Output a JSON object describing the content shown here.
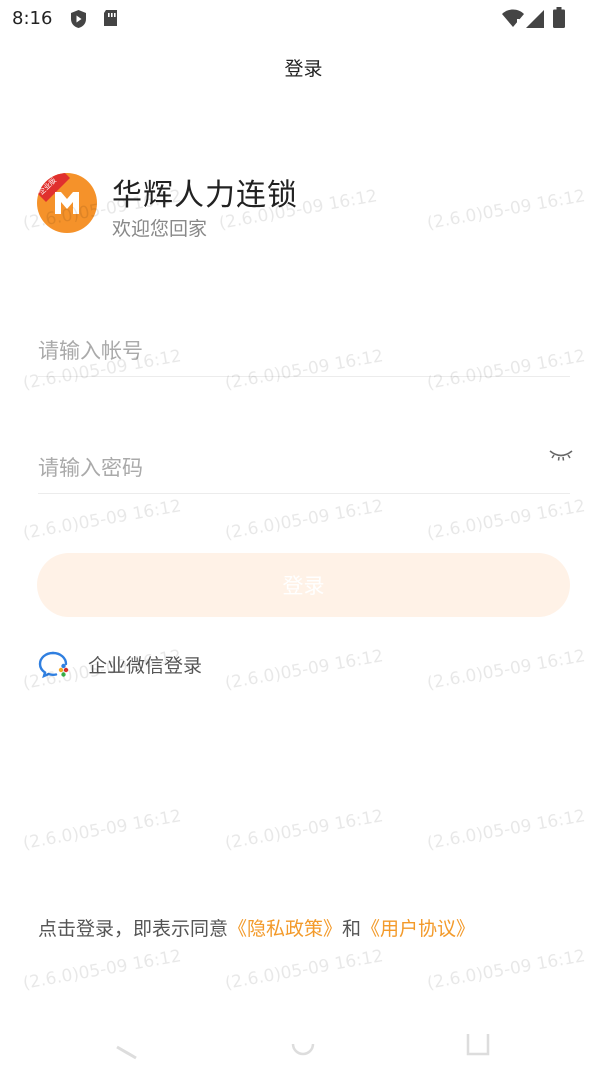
{
  "status_bar": {
    "time": "8:16",
    "left_icons": [
      "shield-icon",
      "sim-card-icon"
    ],
    "right_icons": [
      "wifi-icon",
      "signal-icon",
      "battery-icon"
    ]
  },
  "header": {
    "title": "登录"
  },
  "brand": {
    "logo_badge": "企业版",
    "app_name": "华辉人力连锁",
    "welcome": "欢迎您回家"
  },
  "form": {
    "account_value": "",
    "account_placeholder": "请输入帐号",
    "password_value": "",
    "password_placeholder": "请输入密码",
    "password_toggle_icon": "eye-closed-icon",
    "submit_label": "登录"
  },
  "alt_login": {
    "icon": "wecom-icon",
    "label": "企业微信登录"
  },
  "agreement": {
    "prefix": "点击登录，即表示同意",
    "privacy_link": "《隐私政策》",
    "conjunction": "和",
    "terms_link": "《用户协议》"
  },
  "watermark_text": "(2.6.0)05-09 16:12",
  "colors": {
    "accent": "#f39a2a",
    "button_disabled_bg": "#fff2e7",
    "logo_orange": "#f5922a",
    "logo_red": "#e0302e"
  }
}
